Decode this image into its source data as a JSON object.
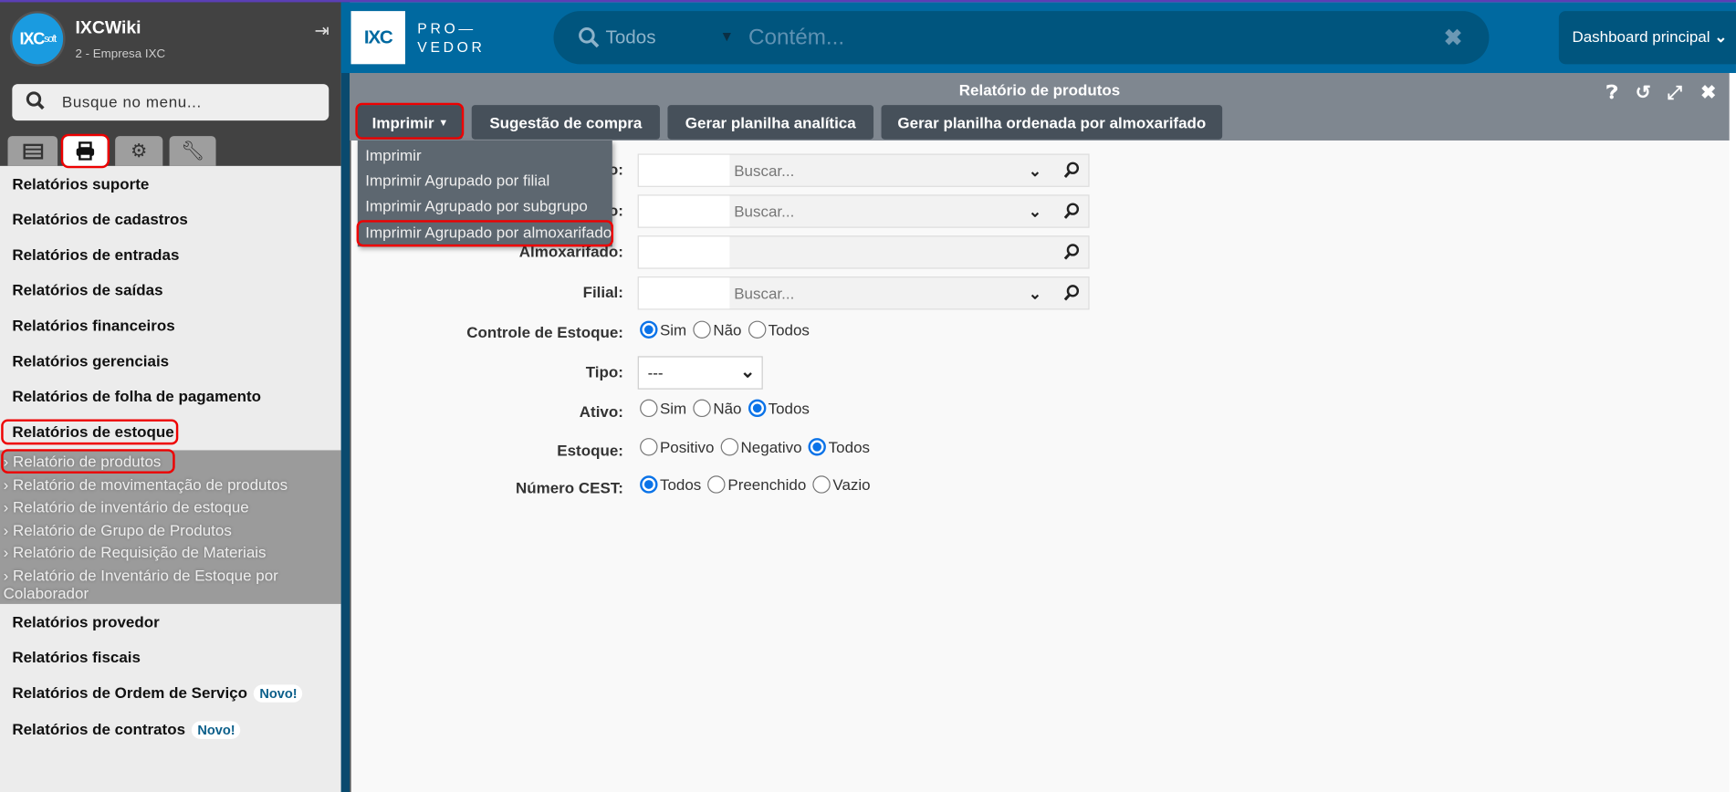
{
  "sidebar": {
    "app_name": "IXCWiki",
    "company": "2 - Empresa IXC",
    "logo_text": "IXC",
    "logo_sub": "soft",
    "search_placeholder": "Busque no menu...",
    "tabs": [
      {
        "icon": "list-icon"
      },
      {
        "icon": "printer-icon",
        "active": true
      },
      {
        "icon": "gears-icon"
      },
      {
        "icon": "wrench-icon"
      }
    ],
    "menu": [
      "Relatórios suporte",
      "Relatórios de cadastros",
      "Relatórios de entradas",
      "Relatórios de saídas",
      "Relatórios financeiros",
      "Relatórios gerenciais",
      "Relatórios de folha de pagamento",
      "Relatórios de estoque"
    ],
    "submenu": [
      "Relatório de produtos",
      "Relatório de movimentação de produtos",
      "Relatório de inventário de estoque",
      "Relatório de Grupo de Produtos",
      "Relatório de Requisição de Materiais",
      "Relatório de Inventário de Estoque por Colaborador"
    ],
    "menu_after": [
      {
        "label": "Relatórios provedor"
      },
      {
        "label": "Relatórios fiscais"
      },
      {
        "label": "Relatórios de Ordem de Serviço",
        "badge": "Novo!"
      },
      {
        "label": "Relatórios de contratos",
        "badge": "Novo!"
      }
    ]
  },
  "topbar": {
    "logo": "IXC",
    "brand_line1": "PRO—",
    "brand_line2": "VEDOR",
    "search_scope": "Todos",
    "search_placeholder": "Contém...",
    "dashboard": "Dashboard principal",
    "accent": "#0069a0"
  },
  "window": {
    "title": "Relatório de produtos",
    "buttons": [
      "Imprimir",
      "Sugestão de compra",
      "Gerar planilha analítica",
      "Gerar planilha ordenada por almoxarifado"
    ],
    "dropdown": [
      "Imprimir",
      "Imprimir Agrupado por filial",
      "Imprimir Agrupado por subgrupo",
      "Imprimir Agrupado por almoxarifado"
    ],
    "fields": [
      {
        "label": "o:",
        "placeholder": "Buscar..."
      },
      {
        "label": "o:",
        "placeholder": "Buscar..."
      },
      {
        "label": "Almoxarifado:",
        "placeholder": ""
      },
      {
        "label": "Filial:",
        "placeholder": "Buscar..."
      }
    ],
    "controle": {
      "label": "Controle de Estoque:",
      "options": [
        "Sim",
        "Não",
        "Todos"
      ],
      "selected": "Sim"
    },
    "tipo": {
      "label": "Tipo:",
      "value": "---"
    },
    "ativo": {
      "label": "Ativo:",
      "options": [
        "Sim",
        "Não",
        "Todos"
      ],
      "selected": "Todos"
    },
    "estoque": {
      "label": "Estoque:",
      "options": [
        "Positivo",
        "Negativo",
        "Todos"
      ],
      "selected": "Todos"
    },
    "cest": {
      "label": "Número CEST:",
      "options": [
        "Todos",
        "Preenchido",
        "Vazio"
      ],
      "selected": "Todos"
    }
  }
}
